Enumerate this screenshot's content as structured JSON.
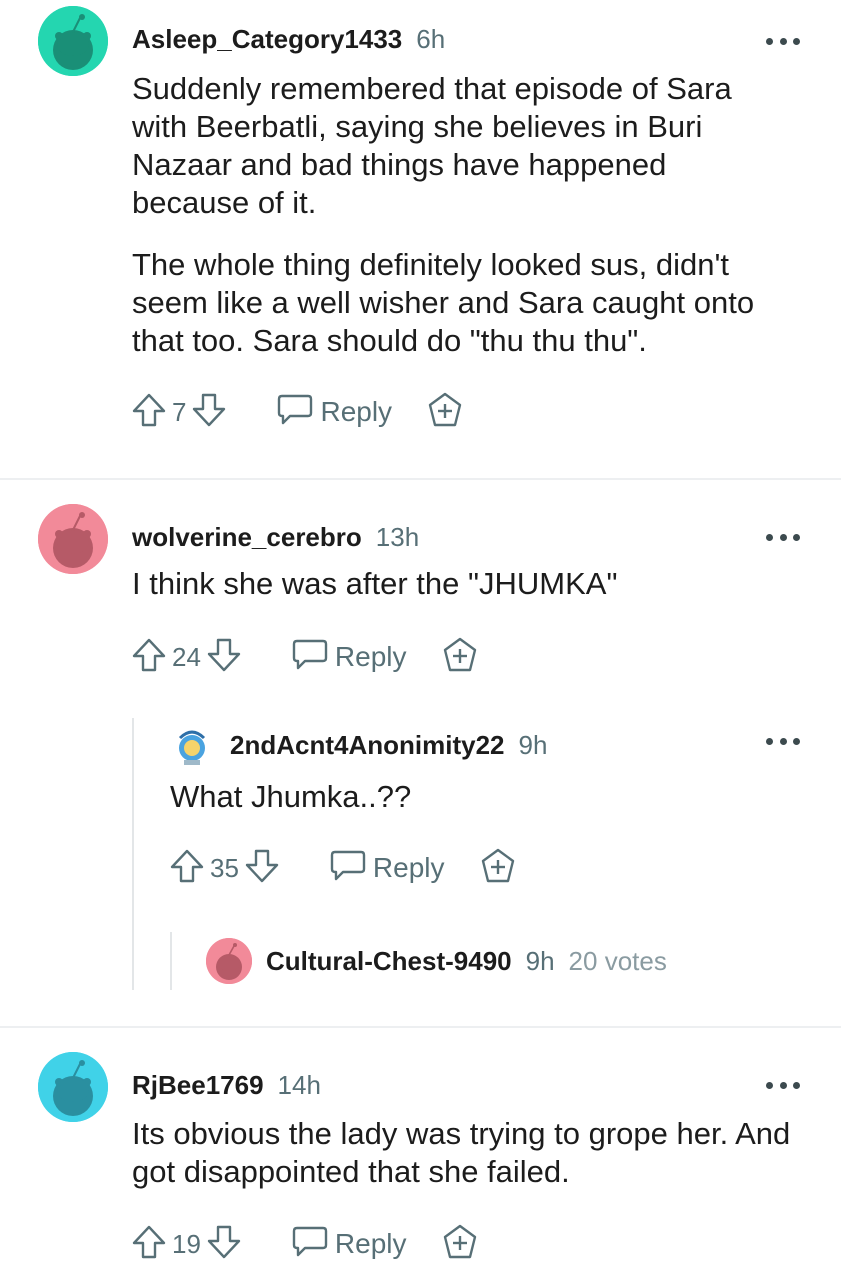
{
  "comments": [
    {
      "username": "Asleep_Category1433",
      "time": "6h",
      "paragraphs": [
        "Suddenly remembered that episode of Sara with Beerbatli, saying she believes in Buri Nazaar and bad things have happened because of it.",
        "The whole thing definitely looked sus, didn't seem like a well wisher and Sara caught onto that too. Sara should do \"thu thu thu\"."
      ],
      "score": "7",
      "reply_label": "Reply",
      "avatar_color": "#24d6b0"
    },
    {
      "username": "wolverine_cerebro",
      "time": "13h",
      "paragraphs": [
        "I think she was after the \"JHUMKA\""
      ],
      "score": "24",
      "reply_label": "Reply",
      "avatar_color": "#f28a99"
    },
    {
      "username": "2ndAcnt4Anonimity22",
      "time": "9h",
      "paragraphs": [
        "What Jhumka..??"
      ],
      "score": "35",
      "reply_label": "Reply",
      "avatar_color": "#4aa3e0"
    },
    {
      "username": "Cultural-Chest-9490",
      "time": "9h",
      "votes_text": "20 votes",
      "avatar_color": "#f28a99"
    },
    {
      "username": "RjBee1769",
      "time": "14h",
      "paragraphs": [
        "Its obvious the lady was trying to grope her. And got disappointed that she failed."
      ],
      "score": "19",
      "reply_label": "Reply",
      "avatar_color": "#40d2e8"
    }
  ],
  "icons": {
    "upvote": "upvote-arrow-icon",
    "downvote": "downvote-arrow-icon",
    "reply": "speech-bubble-icon",
    "award": "award-plus-icon",
    "more": "more-dots-icon"
  }
}
